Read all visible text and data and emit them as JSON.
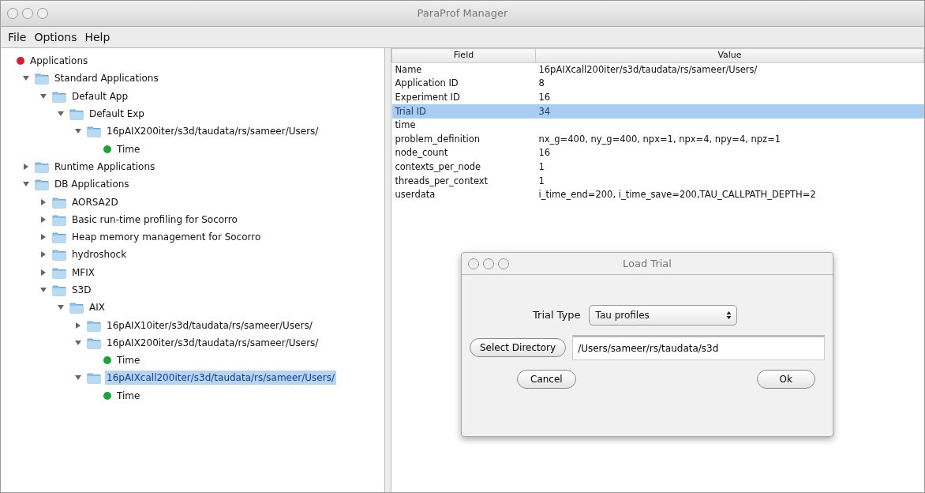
{
  "window": {
    "title": "ParaProf Manager"
  },
  "menu": [
    "File",
    "Options",
    "Help"
  ],
  "tree": [
    {
      "label": "Applications",
      "kind": "dot",
      "color": "#d81e2a",
      "selected": false,
      "children": [
        {
          "label": "Standard Applications",
          "kind": "folder",
          "expanded": true,
          "selected": false,
          "children": [
            {
              "label": "Default App",
              "kind": "folder",
              "expanded": true,
              "selected": false,
              "children": [
                {
                  "label": "Default Exp",
                  "kind": "folder",
                  "expanded": true,
                  "selected": false,
                  "children": [
                    {
                      "label": "16pAIX200iter/s3d/taudata/rs/sameer/Users/",
                      "kind": "folder",
                      "expanded": true,
                      "selected": false,
                      "children": [
                        {
                          "label": "Time",
                          "kind": "dot",
                          "color": "#1fa23a",
                          "selected": false
                        }
                      ]
                    }
                  ]
                }
              ]
            }
          ]
        },
        {
          "label": "Runtime Applications",
          "kind": "folder",
          "expanded": false,
          "selected": false
        },
        {
          "label": "DB Applications",
          "kind": "folder",
          "expanded": true,
          "selected": false,
          "children": [
            {
              "label": "AORSA2D",
              "kind": "folder",
              "expanded": false,
              "selected": false
            },
            {
              "label": "Basic run-time profiling for Socorro",
              "kind": "folder",
              "expanded": false,
              "selected": false
            },
            {
              "label": "Heap memory management for Socorro",
              "kind": "folder",
              "expanded": false,
              "selected": false
            },
            {
              "label": "hydroshock",
              "kind": "folder",
              "expanded": false,
              "selected": false
            },
            {
              "label": "MFIX",
              "kind": "folder",
              "expanded": false,
              "selected": false
            },
            {
              "label": "S3D",
              "kind": "folder",
              "expanded": true,
              "selected": false,
              "children": [
                {
                  "label": "AIX",
                  "kind": "folder",
                  "expanded": true,
                  "selected": false,
                  "children": [
                    {
                      "label": "16pAIX10iter/s3d/taudata/rs/sameer/Users/",
                      "kind": "folder",
                      "expanded": false,
                      "selected": false
                    },
                    {
                      "label": "16pAIX200iter/s3d/taudata/rs/sameer/Users/",
                      "kind": "folder",
                      "expanded": true,
                      "selected": false,
                      "children": [
                        {
                          "label": "Time",
                          "kind": "dot",
                          "color": "#1fa23a",
                          "selected": false
                        }
                      ]
                    },
                    {
                      "label": "16pAIXcall200iter/s3d/taudata/rs/sameer/Users/",
                      "kind": "folder",
                      "expanded": true,
                      "selected": true,
                      "children": [
                        {
                          "label": "Time",
                          "kind": "dot",
                          "color": "#1fa23a",
                          "selected": false
                        }
                      ]
                    }
                  ]
                }
              ]
            }
          ]
        }
      ]
    }
  ],
  "table": {
    "columns": [
      "Field",
      "Value"
    ],
    "rows": [
      {
        "field": "Name",
        "value": "16pAIXcall200iter/s3d/taudata/rs/sameer/Users/",
        "selected": false
      },
      {
        "field": "Application ID",
        "value": "8",
        "selected": false
      },
      {
        "field": "Experiment ID",
        "value": "16",
        "selected": false
      },
      {
        "field": "Trial ID",
        "value": "34",
        "selected": true
      },
      {
        "field": "time",
        "value": "",
        "selected": false
      },
      {
        "field": "problem_definition",
        "value": "nx_g=400, ny_g=400, npx=1, npx=4, npy=4, npz=1",
        "selected": false
      },
      {
        "field": "node_count",
        "value": "16",
        "selected": false
      },
      {
        "field": "contexts_per_node",
        "value": "1",
        "selected": false
      },
      {
        "field": "threads_per_context",
        "value": "1",
        "selected": false
      },
      {
        "field": "userdata",
        "value": "i_time_end=200, i_time_save=200,TAU_CALLPATH_DEPTH=2",
        "selected": false
      }
    ]
  },
  "dialog": {
    "title": "Load Trial",
    "trial_type_label": "Trial Type",
    "trial_type": "Tau profiles",
    "select_directory_button": "Select Directory",
    "directory": "/Users/sameer/rs/taudata/s3d",
    "cancel_button": "Cancel",
    "ok_button": "Ok"
  }
}
